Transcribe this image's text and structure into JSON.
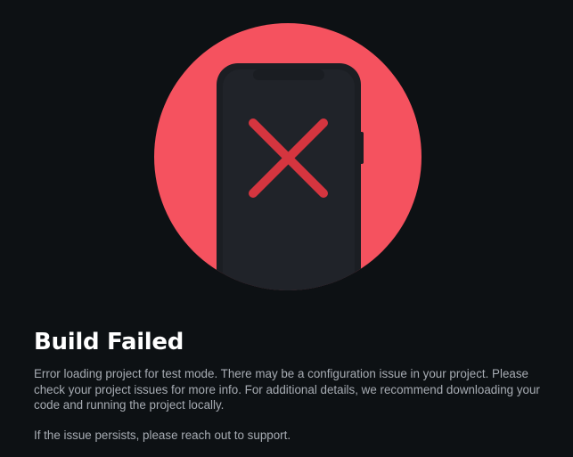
{
  "illustration": {
    "icon": "phone-error-icon",
    "circle_color": "#f5525f",
    "phone_color": "#1e2126",
    "x_mark_color": "#d5353f"
  },
  "error": {
    "title": "Build Failed",
    "message": "Error loading project for test mode. There may be a configuration issue in your project. Please check your project issues for more info. For additional details, we recommend downloading your code and running the project locally.",
    "support": "If the issue persists, please reach out to support."
  },
  "colors": {
    "background": "#0d1114",
    "title": "#ffffff",
    "body_text": "#a7acb3"
  }
}
